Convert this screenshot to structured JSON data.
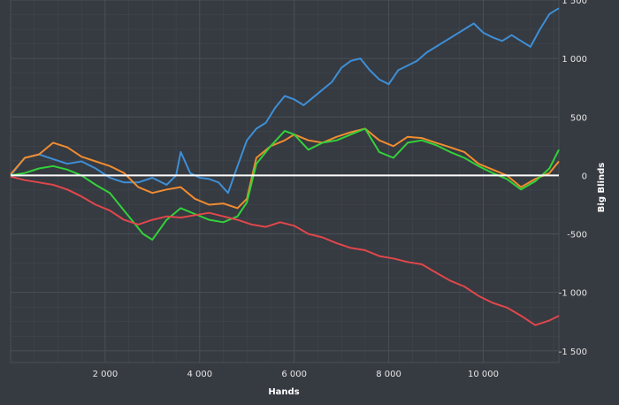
{
  "chart_data": {
    "type": "line",
    "title": "",
    "xlabel": "Hands",
    "ylabel": "Big Blinds",
    "xlim": [
      0,
      11600
    ],
    "ylim": [
      -1600,
      1500
    ],
    "x_ticks": [
      2000,
      4000,
      6000,
      8000,
      10000
    ],
    "x_tick_labels": [
      "2 000",
      "4 000",
      "6 000",
      "8 000",
      "10 000"
    ],
    "y_ticks": [
      1500,
      1000,
      500,
      0,
      -500,
      -1000,
      -1500
    ],
    "y_tick_labels": [
      "1 500",
      "1 000",
      "500",
      "0",
      "-500",
      "-1 000",
      "-1 500"
    ],
    "y_axis_position": "right",
    "grid": true,
    "zero_line": true,
    "legend": "none",
    "colors": {
      "background": "#363a41",
      "grid": "#4a4f57",
      "zero_line": "#ffffff"
    },
    "series": [
      {
        "color": "#3d8fd6",
        "x": [
          0,
          300,
          600,
          900,
          1200,
          1500,
          1800,
          2100,
          2400,
          2700,
          3000,
          3300,
          3500,
          3600,
          3800,
          4000,
          4200,
          4400,
          4600,
          4800,
          5000,
          5200,
          5400,
          5600,
          5800,
          6000,
          6200,
          6500,
          6800,
          7000,
          7200,
          7400,
          7600,
          7800,
          8000,
          8200,
          8400,
          8600,
          8800,
          9000,
          9200,
          9400,
          9600,
          9800,
          10000,
          10200,
          10400,
          10600,
          10800,
          11000,
          11200,
          11400,
          11600
        ],
        "y": [
          0,
          150,
          180,
          140,
          100,
          120,
          60,
          -20,
          -60,
          -60,
          -20,
          -80,
          0,
          200,
          20,
          -20,
          -30,
          -60,
          -150,
          80,
          300,
          400,
          450,
          580,
          680,
          650,
          600,
          700,
          800,
          920,
          980,
          1000,
          900,
          820,
          780,
          900,
          940,
          980,
          1050,
          1100,
          1150,
          1200,
          1250,
          1300,
          1220,
          1180,
          1150,
          1200,
          1150,
          1100,
          1250,
          1380,
          1430
        ]
      },
      {
        "color": "#f08c30",
        "x": [
          0,
          300,
          600,
          900,
          1200,
          1500,
          1800,
          2100,
          2400,
          2700,
          3000,
          3300,
          3600,
          3900,
          4200,
          4500,
          4800,
          5000,
          5200,
          5500,
          5800,
          6000,
          6300,
          6600,
          6900,
          7200,
          7500,
          7800,
          8100,
          8400,
          8700,
          9000,
          9300,
          9600,
          9900,
          10200,
          10500,
          10800,
          11100,
          11400,
          11600
        ],
        "y": [
          10,
          150,
          180,
          280,
          240,
          160,
          120,
          80,
          20,
          -100,
          -150,
          -120,
          -100,
          -200,
          -250,
          -240,
          -280,
          -200,
          150,
          250,
          300,
          350,
          300,
          280,
          330,
          370,
          400,
          300,
          250,
          330,
          320,
          280,
          240,
          200,
          100,
          50,
          0,
          -100,
          -30,
          20,
          120
        ]
      },
      {
        "color": "#32d23a",
        "x": [
          0,
          300,
          600,
          900,
          1200,
          1500,
          1800,
          2100,
          2400,
          2600,
          2800,
          3000,
          3300,
          3600,
          3900,
          4200,
          4500,
          4800,
          5000,
          5200,
          5500,
          5800,
          6000,
          6300,
          6600,
          6900,
          7200,
          7500,
          7800,
          8100,
          8400,
          8700,
          9000,
          9300,
          9600,
          9900,
          10200,
          10500,
          10800,
          11100,
          11400,
          11600
        ],
        "y": [
          0,
          20,
          60,
          80,
          50,
          0,
          -80,
          -150,
          -300,
          -400,
          -500,
          -550,
          -380,
          -280,
          -330,
          -380,
          -400,
          -350,
          -230,
          100,
          250,
          380,
          350,
          220,
          280,
          300,
          350,
          400,
          200,
          150,
          280,
          300,
          260,
          200,
          150,
          80,
          20,
          -30,
          -120,
          -50,
          60,
          220
        ]
      },
      {
        "color": "#e0474b",
        "x": [
          0,
          300,
          600,
          900,
          1200,
          1500,
          1800,
          2100,
          2400,
          2700,
          3000,
          3300,
          3600,
          3900,
          4200,
          4500,
          4800,
          5100,
          5400,
          5700,
          6000,
          6300,
          6600,
          6900,
          7200,
          7500,
          7800,
          8100,
          8400,
          8700,
          9000,
          9300,
          9600,
          9900,
          10200,
          10500,
          10800,
          11100,
          11400,
          11600
        ],
        "y": [
          -10,
          -40,
          -60,
          -80,
          -120,
          -180,
          -250,
          -300,
          -380,
          -420,
          -380,
          -350,
          -360,
          -340,
          -320,
          -350,
          -380,
          -420,
          -440,
          -400,
          -430,
          -500,
          -530,
          -580,
          -620,
          -640,
          -690,
          -710,
          -740,
          -760,
          -830,
          -900,
          -950,
          -1030,
          -1090,
          -1130,
          -1200,
          -1280,
          -1240,
          -1200
        ]
      }
    ]
  }
}
